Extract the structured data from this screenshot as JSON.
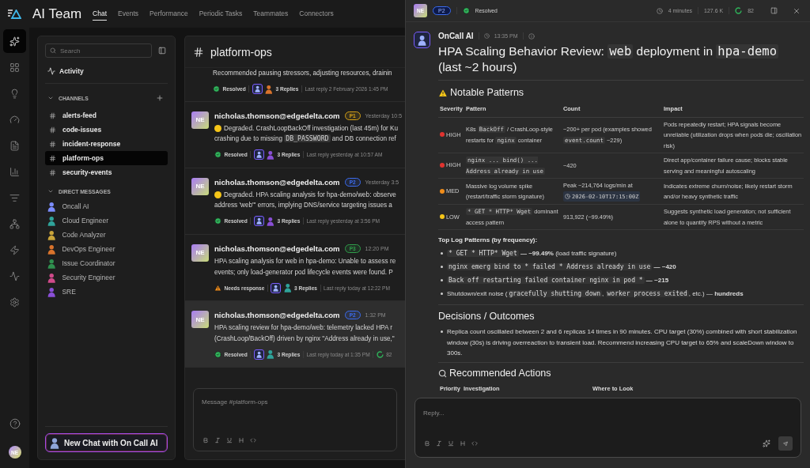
{
  "app": {
    "title": "AI Team",
    "tabs": [
      {
        "label": "Chat",
        "selected": true
      },
      {
        "label": "Events",
        "selected": false
      },
      {
        "label": "Performance",
        "selected": false
      },
      {
        "label": "Periodic Tasks",
        "selected": false
      },
      {
        "label": "Teammates",
        "selected": false
      },
      {
        "label": "Connectors",
        "selected": false
      }
    ]
  },
  "rail": {
    "items": [
      {
        "kind": "sparkle",
        "selected": true
      },
      {
        "kind": "dashboard",
        "selected": false
      },
      {
        "kind": "bulb",
        "selected": false
      },
      {
        "kind": "gauge",
        "selected": false
      },
      {
        "kind": "document",
        "selected": false
      },
      {
        "kind": "chart",
        "selected": false
      },
      {
        "kind": "filter",
        "selected": false
      },
      {
        "kind": "nodes",
        "selected": false
      },
      {
        "kind": "bolt",
        "selected": false
      },
      {
        "kind": "pulse",
        "selected": false
      },
      {
        "kind": "settings",
        "selected": false
      }
    ],
    "user_initials": "NE"
  },
  "sidebar": {
    "search_placeholder": "Search",
    "activity": "Activity",
    "channels_heading": "CHANNELS",
    "channels": [
      {
        "name": "alerts-feed",
        "selected": false
      },
      {
        "name": "code-issues",
        "selected": false
      },
      {
        "name": "incident-response",
        "selected": false
      },
      {
        "name": "platform-ops",
        "selected": true
      },
      {
        "name": "security-events",
        "selected": false
      }
    ],
    "dm_heading": "DIRECT MESSAGES",
    "direct_messages": [
      {
        "name": "Oncall AI",
        "color": "#7b8cff"
      },
      {
        "name": "Cloud Engineer",
        "color": "#2fa39a"
      },
      {
        "name": "Code Analyzer",
        "color": "#c9a43a"
      },
      {
        "name": "DevOps Engineer",
        "color": "#d9732c"
      },
      {
        "name": "Issue Coordinator",
        "color": "#2f8f4e"
      },
      {
        "name": "Security Engineer",
        "color": "#d04a8a"
      },
      {
        "name": "SRE",
        "color": "#8a4fd6"
      }
    ],
    "new_chat": "New Chat with On Call AI"
  },
  "channel": {
    "name": "platform-ops",
    "composer_placeholder": "Message #platform-ops",
    "messages": [
      {
        "selected": false,
        "lines": [
          [
            {
              "kind": "text",
              "text": "Recommended pausing stressors, adjusting resources, drainin"
            }
          ]
        ],
        "status": {
          "kind": "resolved",
          "label": "Resolved"
        },
        "agent": {
          "color": "#d9732c"
        },
        "replies": "3 Replies",
        "last_reply": "Last reply 2 February 2026 1:45 PM"
      },
      {
        "selected": false,
        "author": "nicholas.thomson@edgedelta.com",
        "avatar": "NE",
        "priority": {
          "label": "P1",
          "color": "#d4a017"
        },
        "time": "Yesterday 10:5",
        "dot": {
          "color": "#f5c518"
        },
        "lines": [
          [
            {
              "kind": "text",
              "text": "Degraded. CrashLoopBackOff investigation (last 45m) for Ku"
            }
          ],
          [
            {
              "kind": "text",
              "text": "crashing due to missing "
            },
            {
              "kind": "code",
              "text": "DB_PASSWORD"
            },
            {
              "kind": "text",
              "text": " and DB connection ref"
            }
          ]
        ],
        "status": {
          "kind": "resolved",
          "label": "Resolved"
        },
        "agent": {
          "color": "#8a4fd6"
        },
        "replies": "3 Replies",
        "last_reply": "Last reply yesterday at 10:57 AM"
      },
      {
        "selected": false,
        "author": "nicholas.thomson@edgedelta.com",
        "avatar": "NE",
        "priority": {
          "label": "P2",
          "color": "#3b6cf0"
        },
        "time": "Yesterday 3:5",
        "dot": {
          "color": "#f5c518"
        },
        "lines": [
          [
            {
              "kind": "text",
              "text": "Degraded. HPA scaling analysis for hpa-demo/web: observe"
            }
          ],
          [
            {
              "kind": "text",
              "text": "address 'web'\" errors, implying DNS/service targeting issues a"
            }
          ]
        ],
        "status": {
          "kind": "resolved",
          "label": "Resolved"
        },
        "agent": {
          "color": "#8a4fd6"
        },
        "replies": "3 Replies",
        "last_reply": "Last reply yesterday at 3:56 PM"
      },
      {
        "selected": false,
        "author": "nicholas.thomson@edgedelta.com",
        "avatar": "NE",
        "priority": {
          "label": "P3",
          "color": "#2f9e4a"
        },
        "time": "12:20 PM",
        "lines": [
          [
            {
              "kind": "text",
              "text": "HPA scaling analysis for web in hpa-demo: Unable to assess re"
            }
          ],
          [
            {
              "kind": "text",
              "text": "events; only load-generator pod lifecycle events were found. P"
            }
          ]
        ],
        "status": {
          "kind": "needs_response",
          "label": "Needs response"
        },
        "agent": {
          "color": "#2fa39a"
        },
        "replies": "3 Replies",
        "last_reply": "Last reply today at 12:22 PM"
      },
      {
        "selected": true,
        "author": "nicholas.thomson@edgedelta.com",
        "avatar": "NE",
        "priority": {
          "label": "P2",
          "color": "#3b6cf0"
        },
        "time": "1:32 PM",
        "lines": [
          [
            {
              "kind": "text",
              "text": "HPA scaling review for hpa-demo/web: telemetry lacked HPA r"
            }
          ],
          [
            {
              "kind": "text",
              "text": "(CrashLoop/BackOff) driven by nginx \"Address already in use,\""
            }
          ]
        ],
        "status": {
          "kind": "resolved",
          "label": "Resolved"
        },
        "agent": {
          "color": "#2fa39a"
        },
        "replies": "3 Replies",
        "last_reply": "Last reply today at 1:35 PM",
        "score": "82"
      }
    ]
  },
  "thread": {
    "header": {
      "avatar": "NE",
      "priority": {
        "label": "P2",
        "color": "#3b6cf0"
      },
      "status": {
        "kind": "resolved",
        "label": "Resolved"
      },
      "duration": "4 minutes",
      "tokens": "127.6 K",
      "score": "82"
    },
    "author": "OnCall AI",
    "time": "13:35 PM",
    "title": [
      {
        "kind": "text",
        "text": "HPA Scaling Behavior Review: "
      },
      {
        "kind": "code",
        "text": "web"
      },
      {
        "kind": "text",
        "text": " deployment in "
      },
      {
        "kind": "code",
        "text": "hpa-demo"
      },
      {
        "kind": "text",
        "text": " (last ~2 hours)"
      }
    ],
    "patterns": {
      "heading": "Notable Patterns",
      "columns": [
        "Severity",
        "Pattern",
        "Count",
        "Impact"
      ],
      "rows": [
        {
          "severity": {
            "label": "HIGH",
            "color": "#e0332f"
          },
          "pattern": [
            {
              "kind": "text",
              "text": "K8s "
            },
            {
              "kind": "code",
              "text": "BackOff"
            },
            {
              "kind": "text",
              "text": " / CrashLoop-style restarts for "
            },
            {
              "kind": "code",
              "text": "nginx"
            },
            {
              "kind": "text",
              "text": " container"
            }
          ],
          "count": [
            {
              "kind": "text",
              "text": "~200+ per pod (examples showed "
            },
            {
              "kind": "code",
              "text": "event.count"
            },
            {
              "kind": "text",
              "text": " ~229)"
            }
          ],
          "impact": "Pods repeatedly restart; HPA signals become unreliable (utilization drops when pods die; oscillation risk)"
        },
        {
          "severity": {
            "label": "HIGH",
            "color": "#e0332f"
          },
          "pattern": [
            {
              "kind": "code",
              "text": "nginx ... bind() ... Address already in use"
            }
          ],
          "count": [
            {
              "kind": "text",
              "text": "~420"
            }
          ],
          "impact": "Direct app/container failure cause; blocks stable serving and meaningful autoscaling"
        },
        {
          "severity": {
            "label": "MED",
            "color": "#f08c1a"
          },
          "pattern": [
            {
              "kind": "text",
              "text": "Massive log volume spike (restart/traffic storm signature)"
            }
          ],
          "count": [
            {
              "kind": "text",
              "text": "Peak ~214,764 logs/min at "
            },
            {
              "kind": "time",
              "text": "2026-02-10T17:15:00Z"
            }
          ],
          "impact": "Indicates extreme churn/noise; likely restart storm and/or heavy synthetic traffic"
        },
        {
          "severity": {
            "label": "LOW",
            "color": "#f5c518"
          },
          "pattern": [
            {
              "kind": "code",
              "text": "* GET * HTTP* Wget"
            },
            {
              "kind": "text",
              "text": " dominant access pattern"
            }
          ],
          "count": [
            {
              "kind": "text",
              "text": "913,922 (~99.49%)"
            }
          ],
          "impact": "Suggests synthetic load generation; not sufficient alone to quantify RPS without a metric"
        }
      ]
    },
    "top_patterns": {
      "heading": "Top Log Patterns (by frequency):",
      "items": [
        [
          {
            "kind": "code",
            "text": "* GET * HTTP* Wget"
          },
          {
            "kind": "bold",
            "text": " — ~99.49%"
          },
          {
            "kind": "text",
            "text": " (load traffic signature)"
          }
        ],
        [
          {
            "kind": "code",
            "text": "nginx emerg bind to * failed * Address already in use"
          },
          {
            "kind": "bold",
            "text": " — ~420"
          }
        ],
        [
          {
            "kind": "code",
            "text": "Back off restarting failed container nginx in pod *"
          },
          {
            "kind": "bold",
            "text": " — ~215"
          }
        ],
        [
          {
            "kind": "text",
            "text": "Shutdown/exit noise ("
          },
          {
            "kind": "code",
            "text": "gracefully shutting down"
          },
          {
            "kind": "text",
            "text": ", "
          },
          {
            "kind": "code",
            "text": "worker process exited"
          },
          {
            "kind": "text",
            "text": ", etc.) — "
          },
          {
            "kind": "bold",
            "text": "hundreds"
          }
        ]
      ]
    },
    "decisions": {
      "heading": "Decisions / Outcomes",
      "items": [
        "Replica count oscillated between 2 and 6 replicas 14 times in 90 minutes. CPU target (30%) combined with short stabilization window (30s) is driving overreaction to transient load. Recommend increasing CPU target to 65% and scaleDown window to 300s."
      ]
    },
    "actions": {
      "heading": "Recommended Actions",
      "columns": [
        "Priority",
        "Investigation",
        "Where to Look"
      ]
    },
    "reply_placeholder": "Reply..."
  }
}
